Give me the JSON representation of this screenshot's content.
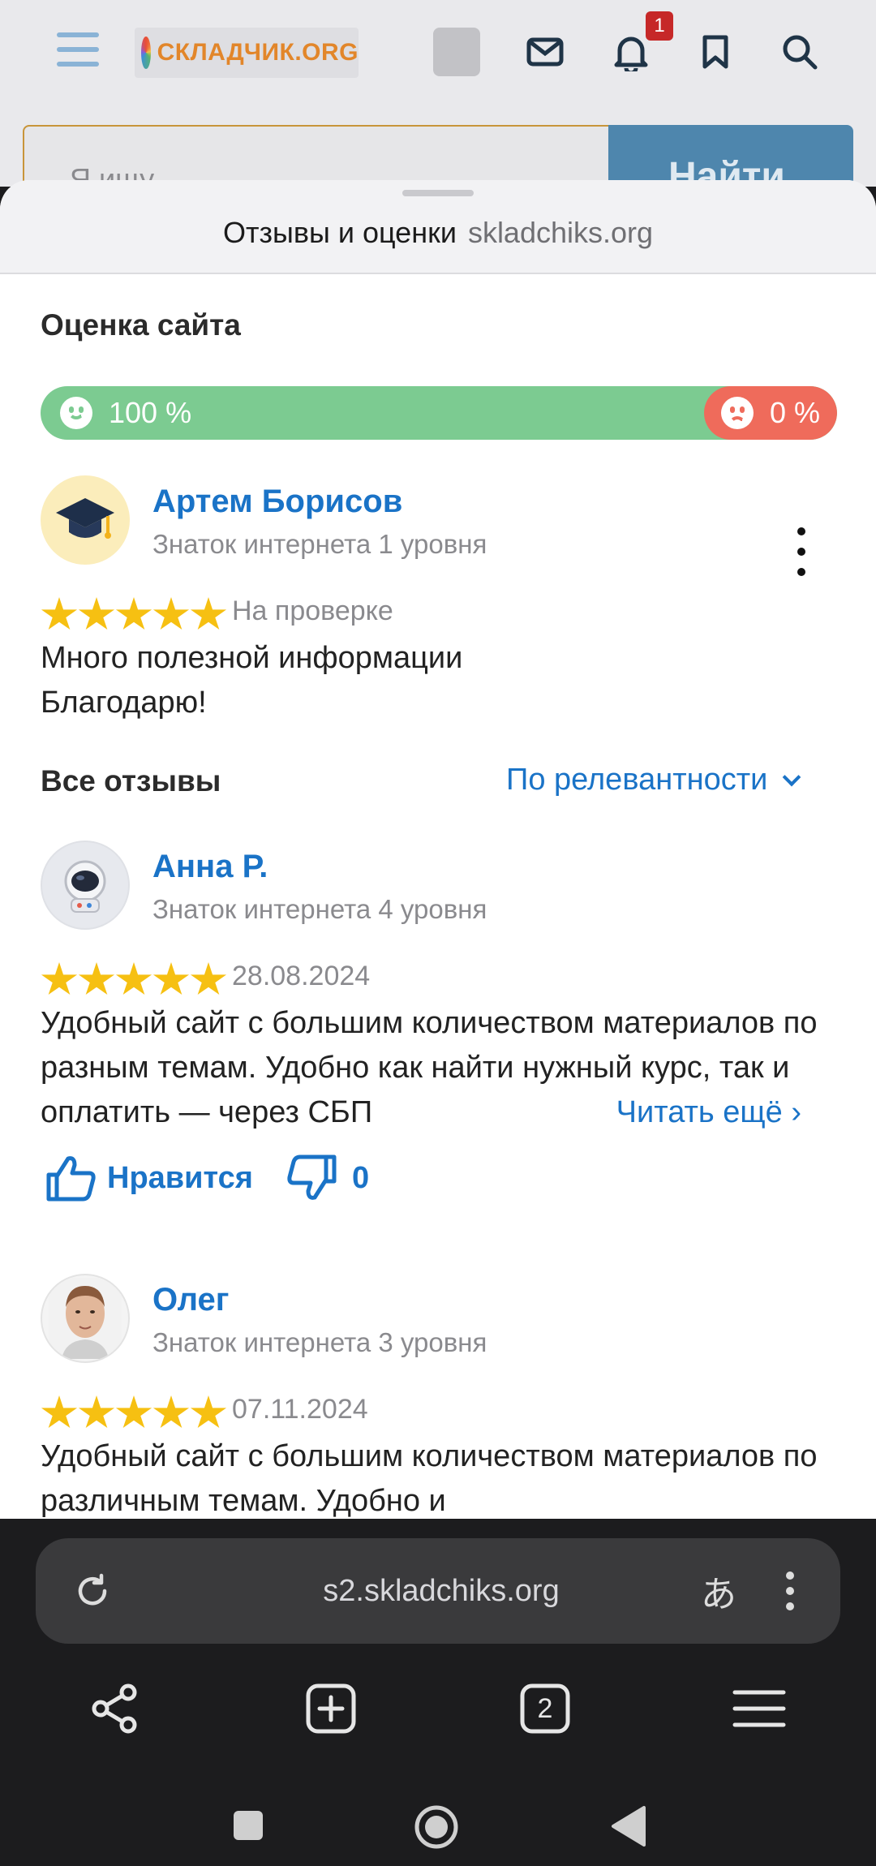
{
  "site": {
    "logo_text": "СКЛАДЧИК.ORG",
    "notification_count": "1",
    "search_placeholder": "Я ищу",
    "search_button": "Найти"
  },
  "sheet": {
    "title": "Отзывы и оценки",
    "domain": "skladchiks.org",
    "site_rating_title": "Оценка сайта",
    "positive_label": "100 %",
    "negative_label": "0 %",
    "positive_share": 1.0
  },
  "my_review": {
    "name": "Артем Борисов",
    "level": "Знаток интернета 1 уровня",
    "stars": 5,
    "status": "На проверке",
    "text_line1": "Много полезной информации",
    "text_line2": "Благодарю!"
  },
  "all_reviews": {
    "title": "Все отзывы",
    "sort_label": "По релевантности",
    "items": [
      {
        "name": "Анна Р.",
        "level": "Знаток интернета 4 уровня",
        "stars": 5,
        "date": "28.08.2024",
        "text": "Удобный сайт с большим количеством материалов по разным темам. Удобно как найти нужный курс, так и оплатить — через СБП",
        "read_more": "Читать ещё ›",
        "like_label": "Нравится",
        "dislike_count": "0"
      },
      {
        "name": "Олег",
        "level": "Знаток интернета 3 уровня",
        "stars": 5,
        "date": "07.11.2024",
        "text": "Удобный сайт с большим количеством материалов по различным темам. Удобно и",
        "read_more": ""
      }
    ]
  },
  "browser": {
    "url": "s2.skladchiks.org",
    "tabs_count": "2",
    "translate_glyph": "あ"
  },
  "colors": {
    "positive": "#7ccb91",
    "negative": "#ef6b5b",
    "link": "#1a73c7",
    "star": "#f6c012"
  }
}
